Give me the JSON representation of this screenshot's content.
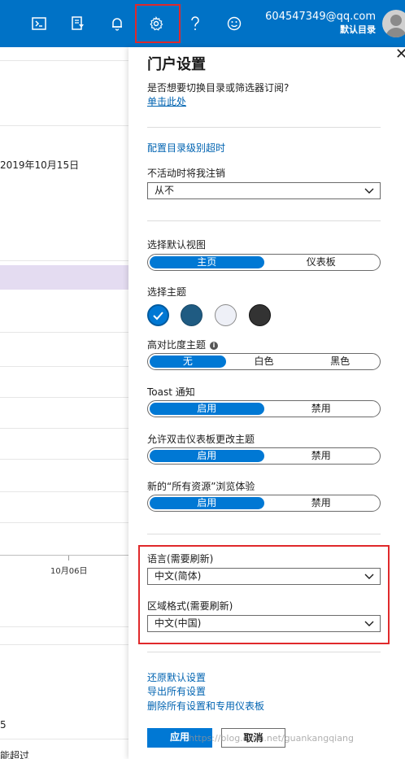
{
  "topbar": {
    "icons": [
      "cloud-shell-icon",
      "directory-filter-icon",
      "notifications-icon",
      "settings-icon",
      "help-icon",
      "feedback-icon"
    ],
    "account_email": "604547349@qq.com",
    "account_directory": "默认目录",
    "bg_color": "#0072c6"
  },
  "background": {
    "date_text": "2019年10月15日",
    "axis_label": "10月06日",
    "bottom_text_1": "5",
    "bottom_text_2": "能超过"
  },
  "panel": {
    "title": "门户设置",
    "switch_question": "是否想要切换目录或筛选器订阅?",
    "switch_link": "单击此处",
    "config_timeout_link": "配置目录级别超时",
    "signout_label": "不活动时将我注销",
    "signout_value": "从不",
    "default_view_label": "选择默认视图",
    "default_view_options": [
      "主页",
      "仪表板"
    ],
    "default_view_selected": 0,
    "theme_label": "选择主题",
    "theme_colors": [
      "#0078d4",
      "#1f5b82",
      "#eef0f7",
      "#333333"
    ],
    "theme_selected": 0,
    "contrast_label": "高对比度主题",
    "contrast_options": [
      "无",
      "白色",
      "黑色"
    ],
    "contrast_selected": 0,
    "toast_label": "Toast 通知",
    "toast_options": [
      "启用",
      "禁用"
    ],
    "toast_selected": 0,
    "dblclick_label": "允许双击仪表板更改主题",
    "dblclick_options": [
      "启用",
      "禁用"
    ],
    "dblclick_selected": 0,
    "allres_label": "新的“所有资源”浏览体验",
    "allres_options": [
      "启用",
      "禁用"
    ],
    "allres_selected": 0,
    "language_label": "语言(需要刷新)",
    "language_value": "中文(简体)",
    "region_label": "区域格式(需要刷新)",
    "region_value": "中文(中国)",
    "restore_link": "还原默认设置",
    "export_link": "导出所有设置",
    "delete_link": "删除所有设置和专用仪表板",
    "apply_button": "应用",
    "cancel_button": "取消"
  },
  "watermark": "https://blog.csdn.net/guankangqiang",
  "highlight_color": "#e0292b"
}
